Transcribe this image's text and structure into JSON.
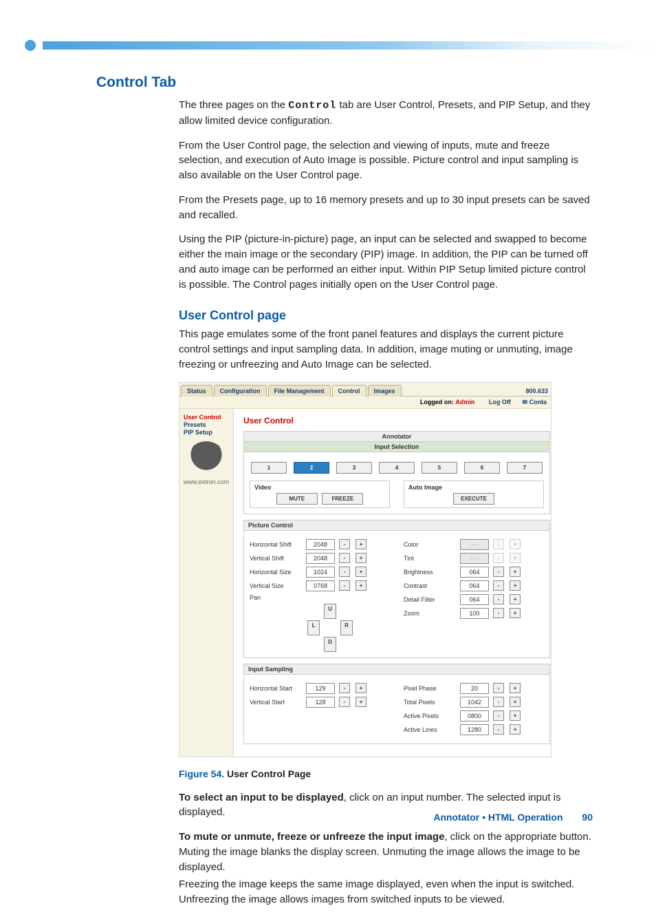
{
  "headings": {
    "control_tab": "Control Tab",
    "user_control_page": "User Control page"
  },
  "paragraphs": {
    "p1a": "The three pages on the ",
    "p1_code": "Control",
    "p1b": " tab are User Control, Presets, and PIP Setup, and they allow limited device configuration.",
    "p2": "From the User Control page, the selection and viewing of inputs, mute and freeze selection, and execution of Auto Image is possible. Picture control and input sampling is also available on the User Control page.",
    "p3": "From the Presets page, up to 16 memory presets and up to 30 input presets can be saved and recalled.",
    "p4": "Using the PIP (picture-in-picture) page, an input can be selected and swapped to become either the main image or the secondary (PIP) image. In addition, the PIP can be turned off and auto image can be performed an either input. Within PIP Setup limited picture control is possible. The Control pages initially open on the User Control page.",
    "p5": "This page emulates some of the front panel features and displays the current picture control settings and input sampling data. In addition, image muting or unmuting, image freezing or unfreezing and Auto Image can be selected."
  },
  "figure": {
    "tabs": [
      "Status",
      "Configuration",
      "File Management",
      "Control",
      "Images"
    ],
    "phone": "800.633",
    "logged_on": "Logged on:",
    "admin": "Admin",
    "logoff": "Log Off",
    "contact_icon": "✉",
    "contact": "Conta",
    "side": {
      "user_control": "User Control",
      "presets": "Presets",
      "pip": "PIP Setup",
      "url": "www.extron.com"
    },
    "main_title": "User Control",
    "annotator": "Annotator",
    "input_selection": "Input Selection",
    "inputs": [
      "1",
      "2",
      "3",
      "4",
      "5",
      "6",
      "7"
    ],
    "selected_input": "2",
    "video": "Video",
    "mute": "MUTE",
    "freeze": "FREEZE",
    "auto_image": "Auto Image",
    "execute": "EXECUTE",
    "picture_control": "Picture Control",
    "pc_left": [
      {
        "label": "Horizontal Shift",
        "value": "2048"
      },
      {
        "label": "Vertical Shift",
        "value": "2048"
      },
      {
        "label": "Horizontal Size",
        "value": "1024"
      },
      {
        "label": "Vertical Size",
        "value": "0768"
      }
    ],
    "pan_label": "Pan",
    "pan_u": "U",
    "pan_l": "L",
    "pan_r": "R",
    "pan_d": "D",
    "pc_right": [
      {
        "label": "Color",
        "value": "----",
        "disabled": true
      },
      {
        "label": "Tint",
        "value": "----",
        "disabled": true
      },
      {
        "label": "Brightness",
        "value": "064"
      },
      {
        "label": "Contrast",
        "value": "064"
      },
      {
        "label": "Detail Filter",
        "value": "064"
      },
      {
        "label": "Zoom",
        "value": "100"
      }
    ],
    "input_sampling": "Input Sampling",
    "is_left": [
      {
        "label": "Horizontal Start",
        "value": "129"
      },
      {
        "label": "Vertical Start",
        "value": "128"
      }
    ],
    "is_right": [
      {
        "label": "Pixel Phase",
        "value": "20"
      },
      {
        "label": "Total Pixels",
        "value": "1042"
      },
      {
        "label": "Active Pixels",
        "value": "0800"
      },
      {
        "label": "Active Lines",
        "value": "1280"
      }
    ],
    "minus": "-",
    "plus": "+"
  },
  "figcaption": {
    "label": "Figure 54.",
    "text": " User Control Page"
  },
  "after": {
    "a1_b": "To select an input to be displayed",
    "a1": ", click on an input number. The selected input is displayed.",
    "a2_b": "To mute or unmute, freeze or unfreeze the input image",
    "a2": ", click on the appropriate button. Muting the image blanks the display screen. Unmuting the image allows the image to be displayed.",
    "a3": "Freezing the image keeps the same image displayed, even when the input is switched. Unfreezing the image allows images from switched inputs to be viewed."
  },
  "footer": {
    "text": "Annotator • HTML Operation",
    "page": "90"
  }
}
